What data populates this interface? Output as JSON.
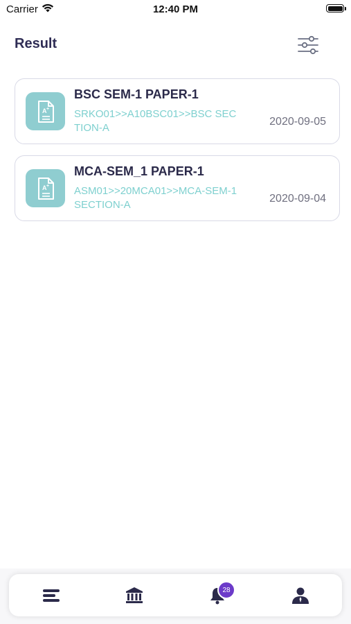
{
  "status_bar": {
    "carrier": "Carrier",
    "time": "12:40 PM",
    "wifi_icon": "wifi-icon",
    "battery_icon": "battery-icon"
  },
  "header": {
    "title": "Result",
    "filter_icon": "filter-sliders-icon"
  },
  "results": [
    {
      "title": "BSC SEM-1 PAPER-1",
      "subtitle": "SRKO01>>A10BSC01>>BSC SECTION-A",
      "date": "2020-09-05",
      "icon": "document-grade-icon"
    },
    {
      "title": "MCA-SEM_1 PAPER-1",
      "subtitle": "ASM01>>20MCA01>>MCA-SEM-1 SECTION-A",
      "date": "2020-09-04",
      "icon": "document-grade-icon"
    }
  ],
  "tabbar": {
    "tabs": [
      {
        "icon": "menu-lines-icon"
      },
      {
        "icon": "institution-icon"
      },
      {
        "icon": "bell-icon",
        "badge": "28"
      },
      {
        "icon": "user-profile-icon"
      }
    ]
  },
  "colors": {
    "accent_teal": "#8fcdd0",
    "subtitle_teal": "#7ed0cf",
    "title_navy": "#2f2d55",
    "badge_purple": "#6c3bc9"
  }
}
